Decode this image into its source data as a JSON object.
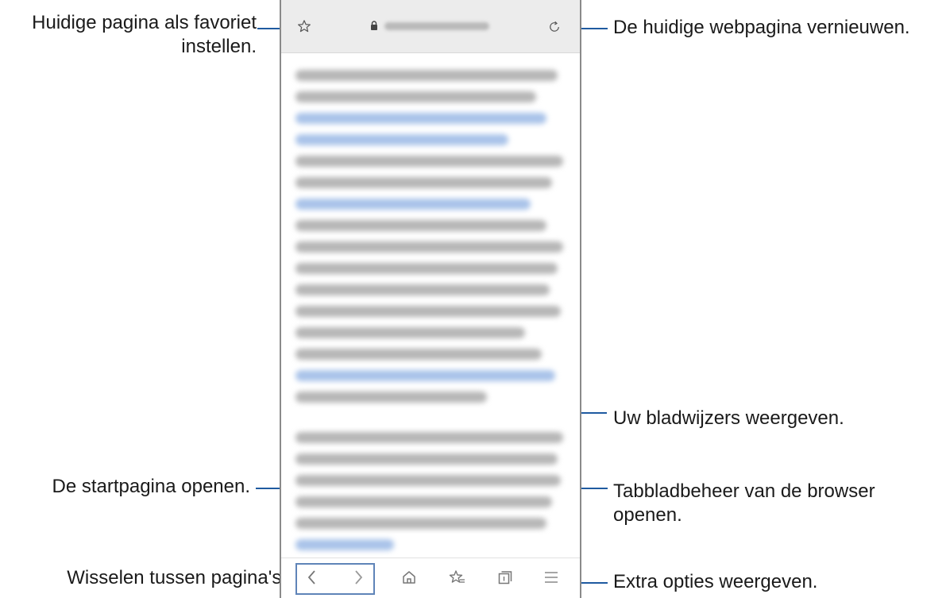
{
  "callouts": {
    "bookmark_current": "Huidige pagina als favoriet\ninstellen.",
    "refresh": "De huidige webpagina vernieuwen.",
    "bookmarks": "Uw bladwijzers weergeven.",
    "home": "De startpagina openen.",
    "tabs": "Tabbladbeheer van de browser\nopenen.",
    "nav": "Wisselen tussen pagina's.",
    "more": "Extra opties weergeven."
  },
  "icons": {
    "star": "star-icon",
    "lock": "lock-icon",
    "refresh": "refresh-icon",
    "back": "chevron-left-icon",
    "forward": "chevron-right-icon",
    "home": "home-icon",
    "bookmarks": "bookmarks-icon",
    "tabs": "tabs-icon",
    "menu": "menu-icon"
  },
  "colors": {
    "leader_line": "#1f5aa0",
    "nav_box": "#5f84b8",
    "address_bar": "#ececec"
  }
}
